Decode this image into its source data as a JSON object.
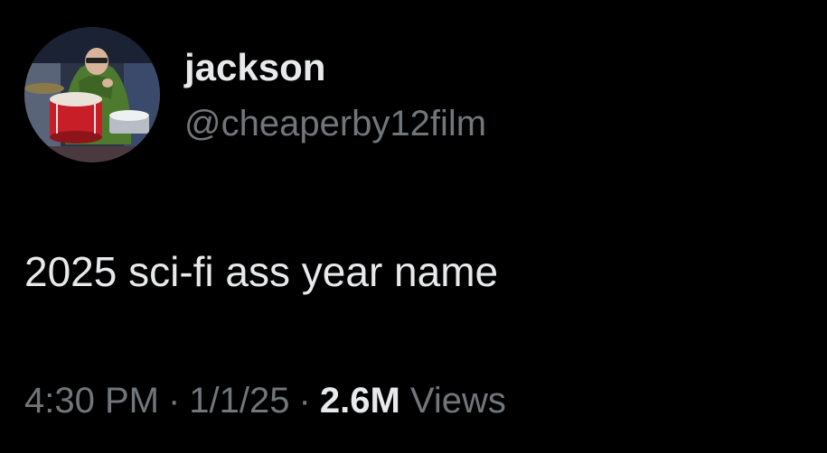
{
  "author": {
    "display_name": "jackson",
    "handle": "@cheaperby12film",
    "avatar": "drummer-profile-photo"
  },
  "tweet": {
    "text": "2025 sci-fi ass year name"
  },
  "meta": {
    "time": "4:30 PM",
    "date": "1/1/25",
    "separator": "·",
    "views_count": "2.6M",
    "views_label": "Views"
  },
  "colors": {
    "background": "#000000",
    "primary_text": "#e7e9ea",
    "secondary_text": "#71767b"
  }
}
